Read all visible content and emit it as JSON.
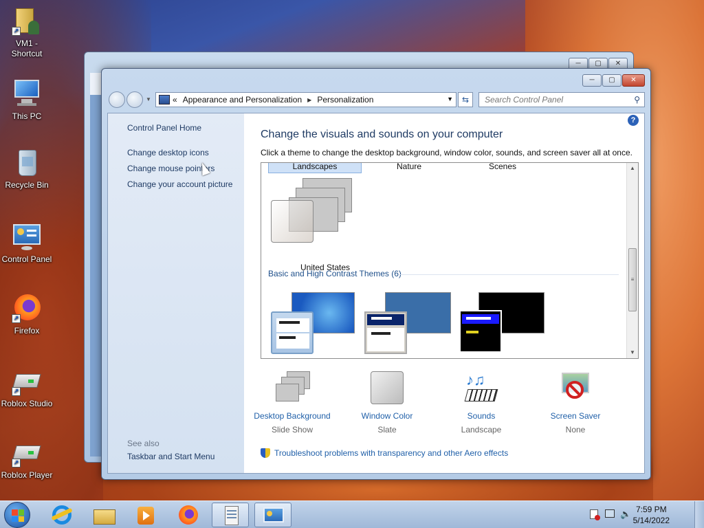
{
  "desktop": {
    "icons": [
      {
        "label": "VM1 - Shortcut",
        "icon": "folder-user-icon"
      },
      {
        "label": "This PC",
        "icon": "computer-icon"
      },
      {
        "label": "Recycle Bin",
        "icon": "recycle-bin-icon"
      },
      {
        "label": "Control Panel",
        "icon": "control-panel-icon"
      },
      {
        "label": "Firefox",
        "icon": "firefox-icon"
      },
      {
        "label": "Roblox Studio",
        "icon": "roblox-studio-icon"
      },
      {
        "label": "Roblox Player",
        "icon": "roblox-player-icon"
      }
    ]
  },
  "window": {
    "breadcrumb_prefix": "«",
    "breadcrumb": [
      "Appearance and Personalization",
      "Personalization"
    ],
    "search_placeholder": "Search Control Panel",
    "buttons": {
      "minimize": "─",
      "maximize": "▢",
      "close": "✕"
    },
    "help": "?"
  },
  "leftpane": {
    "home": "Control Panel Home",
    "links": [
      "Change desktop icons",
      "Change mouse pointers",
      "Change your account picture"
    ],
    "see_also": "See also",
    "see_also_links": [
      "Taskbar and Start Menu"
    ]
  },
  "main": {
    "title": "Change the visuals and sounds on your computer",
    "subtitle": "Click a theme to change the desktop background, window color, sounds, and screen saver all at once.",
    "tabs": [
      "Landscapes",
      "Nature",
      "Scenes"
    ],
    "selected_tab": "Landscapes",
    "theme_label": "United States",
    "section_header": "Basic and High Contrast Themes (6)",
    "bottom_items": [
      {
        "title": "Desktop Background",
        "value": "Slide Show",
        "icon": "desktop-background-icon"
      },
      {
        "title": "Window Color",
        "value": "Slate",
        "icon": "window-color-icon"
      },
      {
        "title": "Sounds",
        "value": "Landscape",
        "icon": "sounds-icon"
      },
      {
        "title": "Screen Saver",
        "value": "None",
        "icon": "screen-saver-icon"
      }
    ],
    "troubleshoot": "Troubleshoot problems with transparency and other Aero effects"
  },
  "taskbar": {
    "time": "7:59 PM",
    "date": "5/14/2022",
    "apps": [
      "internet-explorer-icon",
      "file-explorer-icon",
      "media-player-icon",
      "firefox-icon",
      "notepad-icon",
      "control-panel-icon"
    ]
  },
  "colors": {
    "link": "#1f5fa8",
    "title": "#1e3a63",
    "accent": "#2c62b8"
  }
}
